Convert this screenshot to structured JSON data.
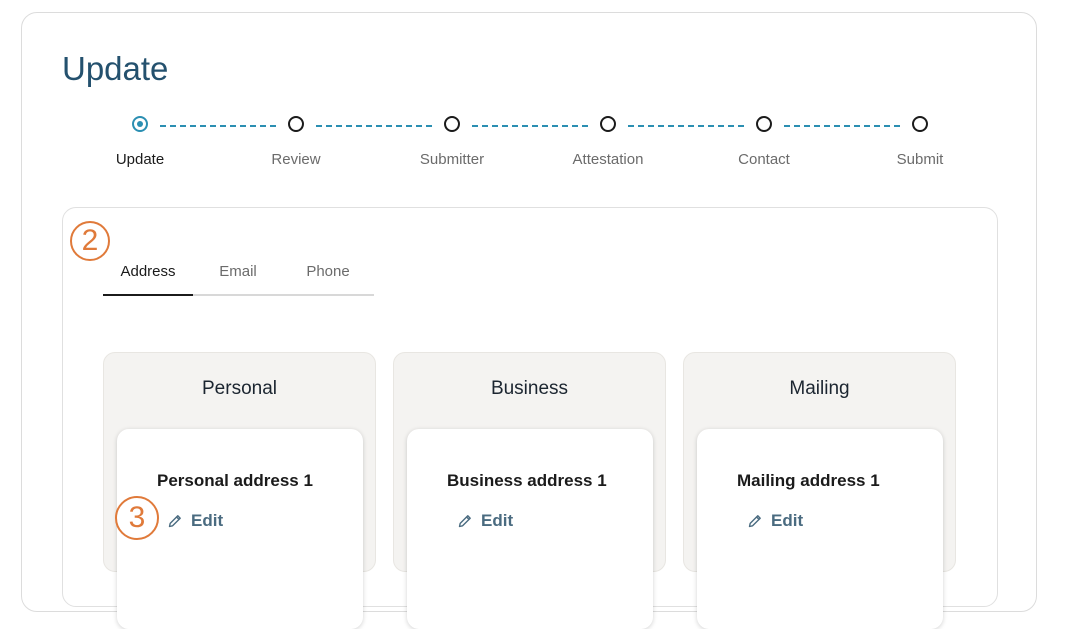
{
  "page": {
    "title": "Update"
  },
  "stepper": {
    "steps": [
      {
        "label": "Update",
        "active": true
      },
      {
        "label": "Review",
        "active": false
      },
      {
        "label": "Submitter",
        "active": false
      },
      {
        "label": "Attestation",
        "active": false
      },
      {
        "label": "Contact",
        "active": false
      },
      {
        "label": "Submit",
        "active": false
      }
    ]
  },
  "annotations": {
    "tabs_marker": "2",
    "edit_marker": "3"
  },
  "tabs": [
    {
      "label": "Address",
      "selected": true
    },
    {
      "label": "Email",
      "selected": false
    },
    {
      "label": "Phone",
      "selected": false
    }
  ],
  "groups": [
    {
      "title": "Personal",
      "address_name": "Personal address 1",
      "edit_label": "Edit"
    },
    {
      "title": "Business",
      "address_name": "Business address 1",
      "edit_label": "Edit"
    },
    {
      "title": "Mailing",
      "address_name": "Mailing address 1",
      "edit_label": "Edit"
    }
  ],
  "colors": {
    "title": "#24516e",
    "step_active": "#2b8fb2",
    "annotation": "#e07a3a",
    "edit_link": "#4a6b80"
  },
  "icons": {
    "edit": "pencil-icon"
  }
}
